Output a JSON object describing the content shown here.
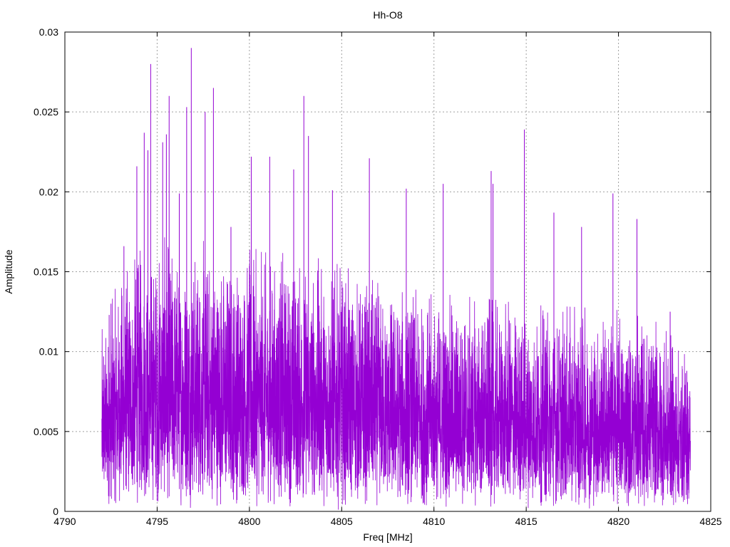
{
  "chart_data": {
    "type": "line",
    "title": "Hh-O8",
    "xlabel": "Freq [MHz]",
    "ylabel": "Amplitude",
    "xlim": [
      4790,
      4825
    ],
    "ylim": [
      0,
      0.03
    ],
    "xticks": [
      4790,
      4795,
      4800,
      4805,
      4810,
      4815,
      4820,
      4825
    ],
    "xtick_labels": [
      "4790",
      "4795",
      "4800",
      "4805",
      "4810",
      "4815",
      "4820",
      "4825"
    ],
    "yticks": [
      0,
      0.005,
      0.01,
      0.015,
      0.02,
      0.025,
      0.03
    ],
    "ytick_labels": [
      "0",
      "0.005",
      "0.01",
      "0.015",
      "0.02",
      "0.025",
      "0.03"
    ],
    "grid": true,
    "legend": "none",
    "colors": {
      "series": "#9400d3",
      "grid": "#a0a0a0",
      "axes": "#000000"
    },
    "series": [
      {
        "x_range": [
          4792.0,
          4823.9
        ],
        "envelope_x": [
          4792.0,
          4793.0,
          4794.0,
          4795.0,
          4796.0,
          4797.0,
          4798.0,
          4800.0,
          4802.0,
          4803.0,
          4805.0,
          4807.0,
          4810.0,
          4813.0,
          4815.0,
          4818.0,
          4820.0,
          4822.0,
          4823.0,
          4823.9
        ],
        "envelope_median": [
          0.0065,
          0.0085,
          0.0095,
          0.0098,
          0.0098,
          0.0098,
          0.0096,
          0.0094,
          0.0093,
          0.0092,
          0.0088,
          0.0082,
          0.0078,
          0.0076,
          0.0074,
          0.0073,
          0.0072,
          0.0068,
          0.0062,
          0.0055
        ],
        "peaks": [
          {
            "x": 4792.1,
            "y": 0.0097
          },
          {
            "x": 4792.4,
            "y": 0.0123
          },
          {
            "x": 4792.5,
            "y": 0.013
          },
          {
            "x": 4793.2,
            "y": 0.0166
          },
          {
            "x": 4793.9,
            "y": 0.0216
          },
          {
            "x": 4794.3,
            "y": 0.0237
          },
          {
            "x": 4794.5,
            "y": 0.0226
          },
          {
            "x": 4794.65,
            "y": 0.028
          },
          {
            "x": 4795.3,
            "y": 0.0231
          },
          {
            "x": 4795.5,
            "y": 0.0236
          },
          {
            "x": 4795.65,
            "y": 0.026
          },
          {
            "x": 4796.2,
            "y": 0.0199
          },
          {
            "x": 4796.6,
            "y": 0.0253
          },
          {
            "x": 4796.85,
            "y": 0.029
          },
          {
            "x": 4797.6,
            "y": 0.025
          },
          {
            "x": 4798.05,
            "y": 0.0265
          },
          {
            "x": 4799.0,
            "y": 0.0178
          },
          {
            "x": 4800.1,
            "y": 0.0222
          },
          {
            "x": 4801.1,
            "y": 0.0222
          },
          {
            "x": 4802.4,
            "y": 0.0214
          },
          {
            "x": 4802.95,
            "y": 0.026
          },
          {
            "x": 4803.2,
            "y": 0.0235
          },
          {
            "x": 4804.5,
            "y": 0.0201
          },
          {
            "x": 4806.5,
            "y": 0.0221
          },
          {
            "x": 4808.5,
            "y": 0.0202
          },
          {
            "x": 4810.5,
            "y": 0.0205
          },
          {
            "x": 4813.1,
            "y": 0.0213
          },
          {
            "x": 4813.2,
            "y": 0.0205
          },
          {
            "x": 4814.9,
            "y": 0.0239
          },
          {
            "x": 4816.5,
            "y": 0.0187
          },
          {
            "x": 4818.0,
            "y": 0.0178
          },
          {
            "x": 4819.7,
            "y": 0.0199
          },
          {
            "x": 4821.0,
            "y": 0.0183
          },
          {
            "x": 4822.8,
            "y": 0.0125
          },
          {
            "x": 4823.7,
            "y": 0.0088
          }
        ]
      }
    ]
  }
}
